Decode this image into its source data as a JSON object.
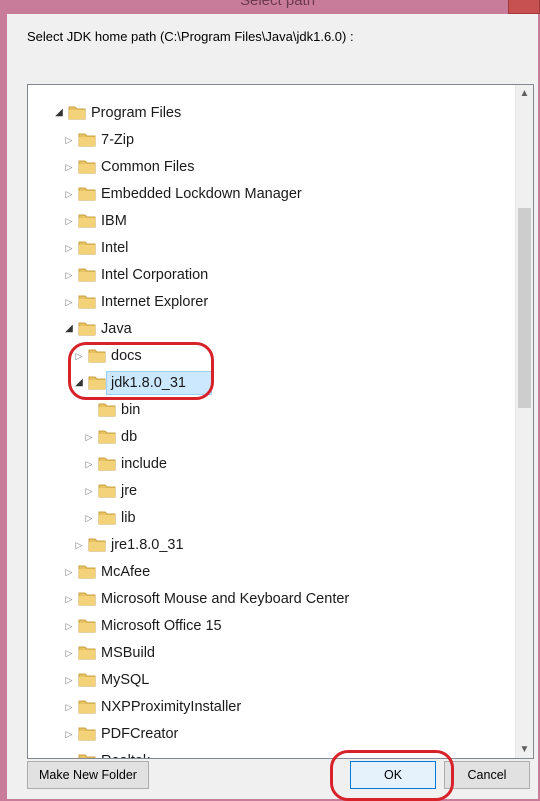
{
  "window": {
    "title": "Select path"
  },
  "dialog": {
    "prompt": "Select JDK home path (C:\\Program Files\\Java\\jdk1.6.0) :",
    "buttons": {
      "make_new_folder": "Make New Folder",
      "ok": "OK",
      "cancel": "Cancel"
    }
  },
  "tree": {
    "items": [
      {
        "label": "Program Files",
        "expanded": true,
        "depth": 0
      },
      {
        "label": "7-Zip",
        "expanded": false,
        "depth": 1
      },
      {
        "label": "Common Files",
        "expanded": false,
        "depth": 1
      },
      {
        "label": "Embedded Lockdown Manager",
        "expanded": false,
        "depth": 1
      },
      {
        "label": "IBM",
        "expanded": false,
        "depth": 1
      },
      {
        "label": "Intel",
        "expanded": false,
        "depth": 1
      },
      {
        "label": "Intel Corporation",
        "expanded": false,
        "depth": 1
      },
      {
        "label": "Internet Explorer",
        "expanded": false,
        "depth": 1
      },
      {
        "label": "Java",
        "expanded": true,
        "depth": 1
      },
      {
        "label": "docs",
        "expanded": false,
        "depth": 2
      },
      {
        "label": "jdk1.8.0_31",
        "expanded": true,
        "depth": 2,
        "selected": true
      },
      {
        "label": "bin",
        "expanded": false,
        "depth": 3,
        "leaf": true
      },
      {
        "label": "db",
        "expanded": false,
        "depth": 3
      },
      {
        "label": "include",
        "expanded": false,
        "depth": 3
      },
      {
        "label": "jre",
        "expanded": false,
        "depth": 3
      },
      {
        "label": "lib",
        "expanded": false,
        "depth": 3
      },
      {
        "label": "jre1.8.0_31",
        "expanded": false,
        "depth": 2
      },
      {
        "label": "McAfee",
        "expanded": false,
        "depth": 1
      },
      {
        "label": "Microsoft Mouse and Keyboard Center",
        "expanded": false,
        "depth": 1
      },
      {
        "label": "Microsoft Office 15",
        "expanded": false,
        "depth": 1
      },
      {
        "label": "MSBuild",
        "expanded": false,
        "depth": 1
      },
      {
        "label": "MySQL",
        "expanded": false,
        "depth": 1
      },
      {
        "label": "NXPProximityInstaller",
        "expanded": false,
        "depth": 1
      },
      {
        "label": "PDFCreator",
        "expanded": false,
        "depth": 1
      },
      {
        "label": "Realtek",
        "expanded": false,
        "depth": 1
      }
    ]
  },
  "icons": {
    "expanded": "triangle-down-right",
    "collapsed": "triangle-right",
    "folder": "folder-icon"
  },
  "colors": {
    "selection": "#cce8ff",
    "annotation": "#d8222a",
    "folder": "#e8c262"
  }
}
